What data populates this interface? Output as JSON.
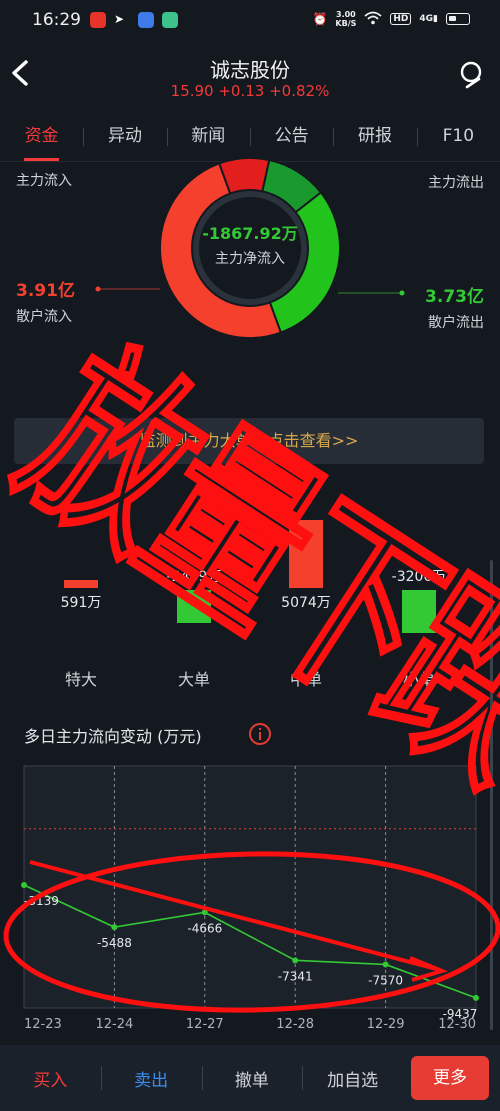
{
  "status": {
    "time": "16:29",
    "speed_value": "3.00",
    "speed_unit": "KB/S",
    "hd": "HD",
    "network": "4G"
  },
  "header": {
    "title": "诚志股份",
    "quote": "15.90 +0.13 +0.82%"
  },
  "tabs": [
    "资金",
    "异动",
    "新闻",
    "公告",
    "研报",
    "F10"
  ],
  "flow": {
    "main_in_label": "主力流入",
    "main_out_label": "主力流出",
    "retail_in_label": "散户流入",
    "retail_out_label": "散户流出",
    "retail_in_value": "3.91亿",
    "retail_out_value": "3.73亿",
    "net_value": "-1867.92万",
    "net_label": "主力净流入",
    "donut_segments": [
      {
        "name": "main-in",
        "fraction": 0.09,
        "color": "#e21e1e"
      },
      {
        "name": "main-out",
        "fraction": 0.11,
        "color": "#1a9a2e"
      },
      {
        "name": "retail-out",
        "fraction": 0.3,
        "color": "#22c41c"
      },
      {
        "name": "retail-in",
        "fraction": 0.5,
        "color": "#f5402e"
      }
    ]
  },
  "notice": "监测到主力大单，点击查看>>",
  "orders": [
    {
      "category": "特大",
      "value_label": "591万",
      "value": 591
    },
    {
      "category": "大单",
      "value_label": "-2459万",
      "value": -2459
    },
    {
      "category": "中单",
      "value_label": "5074万",
      "value": 5074
    },
    {
      "category": "小单",
      "value_label": "-3206万",
      "value": -3206
    }
  ],
  "trend_title": "多日主力流向变动 (万元)",
  "chart_data": {
    "type": "line",
    "x": [
      "12-23",
      "12-24",
      "12-27",
      "12-28",
      "12-29",
      "12-30"
    ],
    "values": [
      -3139,
      -5488,
      -4666,
      -7341,
      -7570,
      -9437
    ],
    "labels": [
      "-3139",
      "-5488",
      "-4666",
      "-7341",
      "-7570",
      "-9437"
    ],
    "ylim": [
      -10000,
      3500
    ],
    "zero_line": 0,
    "line_color": "#33c934"
  },
  "overlay_text": "放量下跌",
  "bottom": [
    "买入",
    "卖出",
    "撤单",
    "加自选",
    "更多"
  ],
  "colors": {
    "up": "#f5402e",
    "down": "#33c934",
    "accent": "#e63c33",
    "notice": "#d8a84a"
  }
}
